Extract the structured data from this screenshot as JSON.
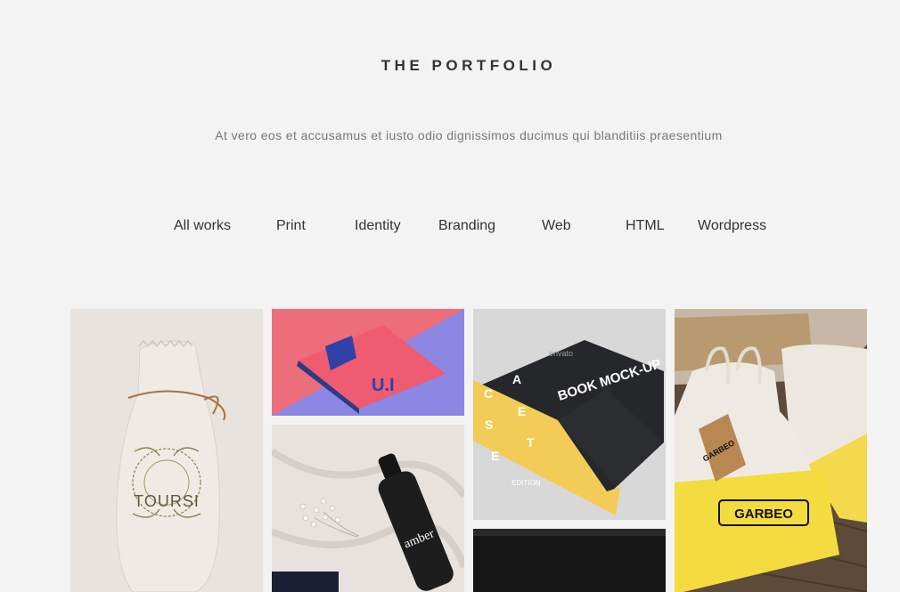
{
  "header": {
    "title": "THE PORTFOLIO",
    "subtitle": "At vero eos et accusamus et iusto odio dignissimos ducimus qui blanditiis praesentium"
  },
  "filters": [
    "All works",
    "Print",
    "Identity",
    "Branding",
    "Web",
    "HTML",
    "Wordpress"
  ],
  "portfolio": {
    "items": [
      {
        "image": "paper-bag-mockup",
        "text": "TOURSI"
      },
      {
        "image": "pink-book-mockup",
        "text": "U.I"
      },
      {
        "image": "amber-bottle-mockup",
        "text": "amber"
      },
      {
        "image": "book-box-mockup",
        "text": "BOOK MOCK-UP",
        "watermark": "envato",
        "edition": "EDITION"
      },
      {
        "image": "tote-bag-mockup",
        "text": "GARBEO"
      },
      {
        "image": "dark-tile",
        "text": ""
      }
    ]
  },
  "colors": {
    "background": "#f3f3f3",
    "text_dark": "#333333",
    "text_muted": "#777777"
  }
}
